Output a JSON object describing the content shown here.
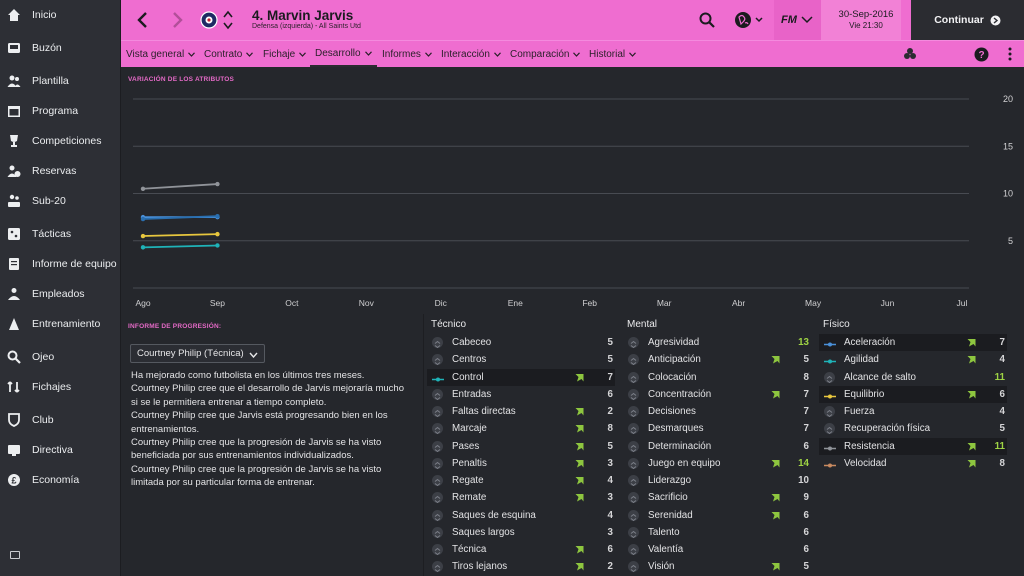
{
  "sidebar": {
    "items": [
      {
        "label": "Inicio",
        "icon": "home-icon"
      },
      {
        "label": "Buzón",
        "icon": "inbox-icon"
      },
      {
        "label": "Plantilla",
        "icon": "squad-icon"
      },
      {
        "label": "Programa",
        "icon": "calendar-icon"
      },
      {
        "label": "Competiciones",
        "icon": "trophy-icon"
      },
      {
        "label": "Reservas",
        "icon": "reserves-icon"
      },
      {
        "label": "Sub-20",
        "icon": "u20-icon"
      },
      {
        "label": "Tácticas",
        "icon": "tactics-icon"
      },
      {
        "label": "Informe de equipo",
        "icon": "report-icon"
      },
      {
        "label": "Empleados",
        "icon": "staff-icon"
      },
      {
        "label": "Entrenamiento",
        "icon": "training-icon"
      },
      {
        "label": "Ojeo",
        "icon": "search-icon"
      },
      {
        "label": "Fichajes",
        "icon": "transfers-icon"
      },
      {
        "label": "Club",
        "icon": "club-icon"
      },
      {
        "label": "Directiva",
        "icon": "board-icon"
      },
      {
        "label": "Economía",
        "icon": "finances-icon"
      }
    ]
  },
  "header": {
    "player_name": "4. Marvin Jarvis",
    "player_subtitle": "Defensa (izquierda) - All Saints Utd",
    "date": "30-Sep-2016",
    "time": "Vie 21:30",
    "continue_label": "Continuar",
    "fm_logo": "FM"
  },
  "tabs": [
    {
      "label": "Vista general"
    },
    {
      "label": "Contrato"
    },
    {
      "label": "Fichaje"
    },
    {
      "label": "Desarrollo",
      "active": true
    },
    {
      "label": "Informes"
    },
    {
      "label": "Interacción"
    },
    {
      "label": "Comparación"
    },
    {
      "label": "Historial"
    }
  ],
  "chart": {
    "title": "VARIACIÓN DE LOS ATRIBUTOS"
  },
  "chart_data": {
    "type": "line",
    "x": [
      "Ago",
      "Sep",
      "Oct",
      "Nov",
      "Dic",
      "Ene",
      "Feb",
      "Mar",
      "Abr",
      "May",
      "Jun",
      "Jul"
    ],
    "ylim": [
      0,
      20
    ],
    "yticks": [
      5,
      10,
      15,
      20
    ],
    "grid": true,
    "series": [
      {
        "color": "#909399",
        "values": [
          10.5,
          11
        ]
      },
      {
        "color": "#4a90d9",
        "values": [
          7.5,
          7.5
        ]
      },
      {
        "color": "#2a6fb0",
        "values": [
          7.3,
          7.6
        ]
      },
      {
        "color": "#e8c73e",
        "values": [
          5.5,
          5.7
        ]
      },
      {
        "color": "#1fb3b8",
        "values": [
          4.3,
          4.5
        ]
      }
    ]
  },
  "progression": {
    "title": "INFORME DE PROGRESIÓN:",
    "coach": "Courtney Philip (Técnica)",
    "lines": [
      "Ha mejorado como futbolista en los últimos tres meses.",
      "Courtney Philip cree que el desarrollo de Jarvis mejoraría mucho",
      "si se le permitiera entrenar a tiempo completo.",
      "Courtney Philip cree que Jarvis está progresando bien en los",
      "entrenamientos.",
      "Courtney Philip cree que la progresión de Jarvis se ha visto",
      "beneficiada por sus entrenamientos individualizados.",
      "Courtney Philip cree que la progresión de Jarvis se ha visto",
      "limitada por su particular forma de entrenar."
    ]
  },
  "attributes": {
    "technical": {
      "title": "Técnico",
      "rows": [
        {
          "name": "Cabeceo",
          "value": "5",
          "arrow": false
        },
        {
          "name": "Centros",
          "value": "5",
          "arrow": false
        },
        {
          "name": "Control",
          "value": "7",
          "arrow": true,
          "highlight": true,
          "line_color": "#1fb3b8"
        },
        {
          "name": "Entradas",
          "value": "6",
          "arrow": false
        },
        {
          "name": "Faltas directas",
          "value": "2",
          "arrow": true
        },
        {
          "name": "Marcaje",
          "value": "8",
          "arrow": true
        },
        {
          "name": "Pases",
          "value": "5",
          "arrow": true
        },
        {
          "name": "Penaltis",
          "value": "3",
          "arrow": true
        },
        {
          "name": "Regate",
          "value": "4",
          "arrow": true
        },
        {
          "name": "Remate",
          "value": "3",
          "arrow": true
        },
        {
          "name": "Saques de esquina",
          "value": "4",
          "arrow": false
        },
        {
          "name": "Saques largos",
          "value": "3",
          "arrow": false
        },
        {
          "name": "Técnica",
          "value": "6",
          "arrow": true
        },
        {
          "name": "Tiros lejanos",
          "value": "2",
          "arrow": true
        }
      ]
    },
    "mental": {
      "title": "Mental",
      "rows": [
        {
          "name": "Agresividad",
          "value": "13",
          "arrow": false,
          "hi": true
        },
        {
          "name": "Anticipación",
          "value": "5",
          "arrow": true
        },
        {
          "name": "Colocación",
          "value": "8",
          "arrow": false
        },
        {
          "name": "Concentración",
          "value": "7",
          "arrow": true
        },
        {
          "name": "Decisiones",
          "value": "7",
          "arrow": false
        },
        {
          "name": "Desmarques",
          "value": "7",
          "arrow": false
        },
        {
          "name": "Determinación",
          "value": "6",
          "arrow": false
        },
        {
          "name": "Juego en equipo",
          "value": "14",
          "arrow": true,
          "hi": true
        },
        {
          "name": "Liderazgo",
          "value": "10",
          "arrow": false
        },
        {
          "name": "Sacrificio",
          "value": "9",
          "arrow": true
        },
        {
          "name": "Serenidad",
          "value": "6",
          "arrow": true
        },
        {
          "name": "Talento",
          "value": "6",
          "arrow": false
        },
        {
          "name": "Valentía",
          "value": "6",
          "arrow": false
        },
        {
          "name": "Visión",
          "value": "5",
          "arrow": true
        }
      ]
    },
    "physical": {
      "title": "Físico",
      "rows": [
        {
          "name": "Aceleración",
          "value": "7",
          "arrow": true,
          "highlight": true,
          "line_color": "#4a90d9"
        },
        {
          "name": "Agilidad",
          "value": "4",
          "arrow": true,
          "line_color": "#1fb3b8"
        },
        {
          "name": "Alcance de salto",
          "value": "11",
          "arrow": false,
          "hi": true
        },
        {
          "name": "Equilibrio",
          "value": "6",
          "arrow": true,
          "highlight": true,
          "line_color": "#e8c73e"
        },
        {
          "name": "Fuerza",
          "value": "4",
          "arrow": false
        },
        {
          "name": "Recuperación física",
          "value": "5",
          "arrow": false
        },
        {
          "name": "Resistencia",
          "value": "11",
          "arrow": true,
          "highlight": true,
          "hi": true,
          "line_color": "#909399"
        },
        {
          "name": "Velocidad",
          "value": "8",
          "arrow": true,
          "line_color": "#c98a60"
        }
      ]
    }
  }
}
